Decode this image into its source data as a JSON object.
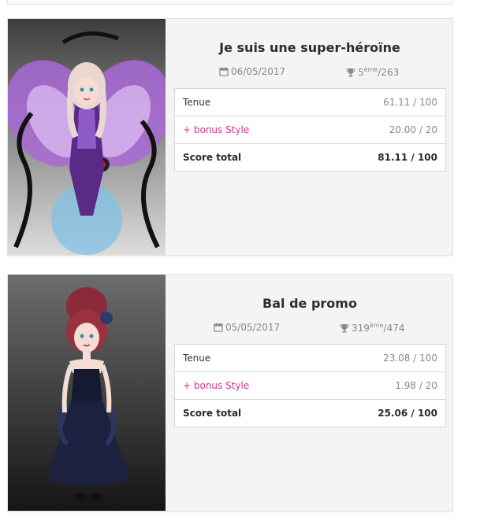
{
  "entries": [
    {
      "title": "Je suis une super-héroïne",
      "date": "06/05/2017",
      "rank": {
        "position": "5",
        "suffix": "ème",
        "total": "/263"
      },
      "rows": [
        {
          "label": "Tenue",
          "value": "61.11 / 100"
        },
        {
          "label": "+ bonus Style",
          "value": "20.00 / 20"
        },
        {
          "label": "Score total",
          "value": "81.11 / 100"
        }
      ]
    },
    {
      "title": "Bal de promo",
      "date": "05/05/2017",
      "rank": {
        "position": "319",
        "suffix": "ème",
        "total": "/474"
      },
      "rows": [
        {
          "label": "Tenue",
          "value": "23.08 / 100"
        },
        {
          "label": "+ bonus Style",
          "value": "1.98 / 20"
        },
        {
          "label": "Score total",
          "value": "25.06 / 100"
        }
      ]
    }
  ],
  "icons": {
    "date": "calendar-icon",
    "rank": "trophy-icon"
  },
  "colors": {
    "bonus": "#d6338f",
    "card_bg": "#f4f4f4"
  }
}
